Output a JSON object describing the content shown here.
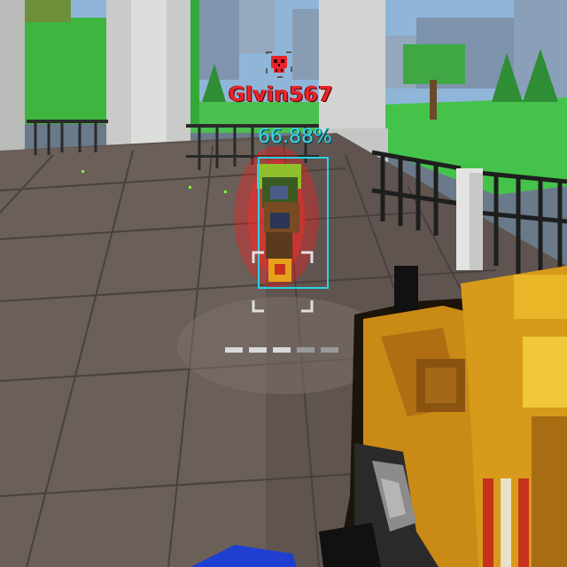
{
  "hud": {
    "enemy_name": "Glvin567",
    "target_percent": "66.88%",
    "enemy_icon": "skull-icon",
    "colors": {
      "enemy_name": "#e8242a",
      "target_percent": "#37d6e8",
      "target_box": "#2fd0e0",
      "crosshair": "#e0e0e0"
    }
  }
}
